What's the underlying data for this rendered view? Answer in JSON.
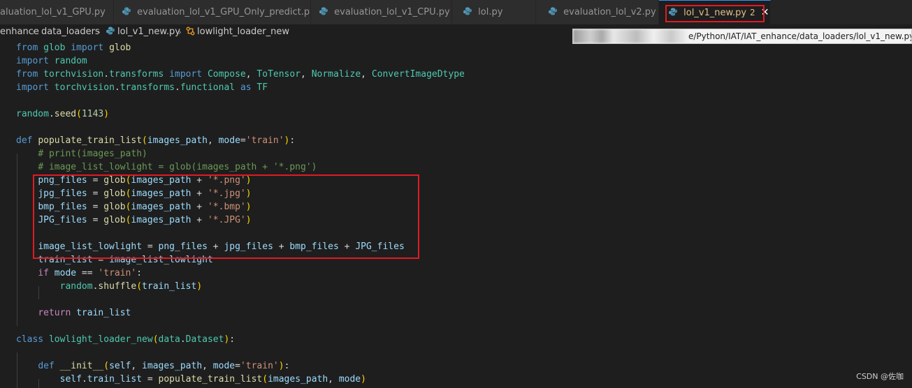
{
  "tabs": [
    {
      "label": "aluation_lol_v1_GPU.py",
      "active": false,
      "icon": "python-file-icon"
    },
    {
      "label": "evaluation_lol_v1_GPU_Only_predict.py",
      "active": false,
      "icon": "python-file-icon"
    },
    {
      "label": "evaluation_lol_v1_CPU.py",
      "active": false,
      "icon": "python-file-icon"
    },
    {
      "label": "lol.py",
      "active": false,
      "icon": "python-file-icon"
    },
    {
      "label": "evaluation_lol_v2.py",
      "active": false,
      "icon": "python-file-icon"
    },
    {
      "label": "lol_v1_new.py",
      "active": true,
      "badge": "2",
      "icon": "python-file-icon",
      "close": "✕"
    }
  ],
  "breadcrumb": {
    "items": [
      "enhance",
      "data_loaders",
      "lol_v1_new.py",
      "lowlight_loader_new"
    ],
    "separator": "›"
  },
  "tooltip": {
    "path_visible": "/Python/IAT/IAT_enhance/data_loaders/lol_v1_new.py",
    "prefix_redacted": "e"
  },
  "code": {
    "lines": [
      [
        [
          "kw",
          "from"
        ],
        [
          "pl",
          " "
        ],
        [
          "mod",
          "glob"
        ],
        [
          "pl",
          " "
        ],
        [
          "kw",
          "import"
        ],
        [
          "pl",
          " "
        ],
        [
          "fn",
          "glob"
        ]
      ],
      [
        [
          "kw",
          "import"
        ],
        [
          "pl",
          " "
        ],
        [
          "mod",
          "random"
        ]
      ],
      [
        [
          "kw",
          "from"
        ],
        [
          "pl",
          " "
        ],
        [
          "mod",
          "torchvision"
        ],
        [
          "pl",
          "."
        ],
        [
          "mod",
          "transforms"
        ],
        [
          "pl",
          " "
        ],
        [
          "kw",
          "import"
        ],
        [
          "pl",
          " "
        ],
        [
          "cls",
          "Compose"
        ],
        [
          "pl",
          ", "
        ],
        [
          "cls",
          "ToTensor"
        ],
        [
          "pl",
          ", "
        ],
        [
          "cls",
          "Normalize"
        ],
        [
          "pl",
          ", "
        ],
        [
          "cls",
          "ConvertImageDtype"
        ]
      ],
      [
        [
          "kw",
          "import"
        ],
        [
          "pl",
          " "
        ],
        [
          "mod",
          "torchvision"
        ],
        [
          "pl",
          "."
        ],
        [
          "mod",
          "transforms"
        ],
        [
          "pl",
          "."
        ],
        [
          "mod",
          "functional"
        ],
        [
          "pl",
          " "
        ],
        [
          "kw",
          "as"
        ],
        [
          "pl",
          " "
        ],
        [
          "mod",
          "TF"
        ]
      ],
      [],
      [
        [
          "mod",
          "random"
        ],
        [
          "pl",
          "."
        ],
        [
          "fn",
          "seed"
        ],
        [
          "par",
          "("
        ],
        [
          "num",
          "1143"
        ],
        [
          "par",
          ")"
        ]
      ],
      [],
      [
        [
          "kw",
          "def"
        ],
        [
          "pl",
          " "
        ],
        [
          "fn",
          "populate_train_list"
        ],
        [
          "par",
          "("
        ],
        [
          "var",
          "images_path"
        ],
        [
          "pl",
          ", "
        ],
        [
          "var",
          "mode"
        ],
        [
          "op",
          "="
        ],
        [
          "str",
          "'train'"
        ],
        [
          "par",
          ")"
        ],
        [
          "pl",
          ":"
        ]
      ],
      [
        [
          "pl",
          "    "
        ],
        [
          "cmt",
          "# print(images_path)"
        ]
      ],
      [
        [
          "pl",
          "    "
        ],
        [
          "cmt",
          "# image_list_lowlight = glob(images_path + '*.png')"
        ]
      ],
      [
        [
          "pl",
          "    "
        ],
        [
          "var",
          "png_files"
        ],
        [
          "op",
          " = "
        ],
        [
          "fn",
          "glob"
        ],
        [
          "par",
          "("
        ],
        [
          "var",
          "images_path"
        ],
        [
          "op",
          " + "
        ],
        [
          "str",
          "'*.png'"
        ],
        [
          "par",
          ")"
        ]
      ],
      [
        [
          "pl",
          "    "
        ],
        [
          "var",
          "jpg_files"
        ],
        [
          "op",
          " = "
        ],
        [
          "fn",
          "glob"
        ],
        [
          "par",
          "("
        ],
        [
          "var",
          "images_path"
        ],
        [
          "op",
          " + "
        ],
        [
          "str",
          "'*.jpg'"
        ],
        [
          "par",
          ")"
        ]
      ],
      [
        [
          "pl",
          "    "
        ],
        [
          "var",
          "bmp_files"
        ],
        [
          "op",
          " = "
        ],
        [
          "fn",
          "glob"
        ],
        [
          "par",
          "("
        ],
        [
          "var",
          "images_path"
        ],
        [
          "op",
          " + "
        ],
        [
          "str",
          "'*.bmp'"
        ],
        [
          "par",
          ")"
        ]
      ],
      [
        [
          "pl",
          "    "
        ],
        [
          "var",
          "JPG_files"
        ],
        [
          "op",
          " = "
        ],
        [
          "fn",
          "glob"
        ],
        [
          "par",
          "("
        ],
        [
          "var",
          "images_path"
        ],
        [
          "op",
          " + "
        ],
        [
          "str",
          "'*.JPG'"
        ],
        [
          "par",
          ")"
        ]
      ],
      [],
      [
        [
          "pl",
          "    "
        ],
        [
          "var",
          "image_list_lowlight"
        ],
        [
          "op",
          " = "
        ],
        [
          "var",
          "png_files"
        ],
        [
          "op",
          " + "
        ],
        [
          "var",
          "jpg_files"
        ],
        [
          "op",
          " + "
        ],
        [
          "var",
          "bmp_files"
        ],
        [
          "op",
          " + "
        ],
        [
          "var",
          "JPG_files"
        ]
      ],
      [
        [
          "pl",
          "    "
        ],
        [
          "var",
          "train_list"
        ],
        [
          "op",
          " = "
        ],
        [
          "var",
          "image_list_lowlight"
        ]
      ],
      [
        [
          "pl",
          "    "
        ],
        [
          "imp",
          "if"
        ],
        [
          "pl",
          " "
        ],
        [
          "var",
          "mode"
        ],
        [
          "op",
          " == "
        ],
        [
          "str",
          "'train'"
        ],
        [
          "pl",
          ":"
        ]
      ],
      [
        [
          "pl",
          "        "
        ],
        [
          "mod",
          "random"
        ],
        [
          "pl",
          "."
        ],
        [
          "fn",
          "shuffle"
        ],
        [
          "par",
          "("
        ],
        [
          "var",
          "train_list"
        ],
        [
          "par",
          ")"
        ]
      ],
      [],
      [
        [
          "pl",
          "    "
        ],
        [
          "imp",
          "return"
        ],
        [
          "pl",
          " "
        ],
        [
          "var",
          "train_list"
        ]
      ],
      [],
      [
        [
          "kw",
          "class"
        ],
        [
          "pl",
          " "
        ],
        [
          "cls",
          "lowlight_loader_new"
        ],
        [
          "par",
          "("
        ],
        [
          "mod",
          "data"
        ],
        [
          "pl",
          "."
        ],
        [
          "cls",
          "Dataset"
        ],
        [
          "par",
          ")"
        ],
        [
          "pl",
          ":"
        ]
      ],
      [],
      [
        [
          "pl",
          "    "
        ],
        [
          "kw",
          "def"
        ],
        [
          "pl",
          " "
        ],
        [
          "fn",
          "__init__"
        ],
        [
          "par",
          "("
        ],
        [
          "var",
          "self"
        ],
        [
          "pl",
          ", "
        ],
        [
          "var",
          "images_path"
        ],
        [
          "pl",
          ", "
        ],
        [
          "var",
          "mode"
        ],
        [
          "op",
          "="
        ],
        [
          "str",
          "'train'"
        ],
        [
          "par",
          ")"
        ],
        [
          "pl",
          ":"
        ]
      ],
      [
        [
          "pl",
          "        "
        ],
        [
          "var",
          "self"
        ],
        [
          "pl",
          "."
        ],
        [
          "var",
          "train_list"
        ],
        [
          "op",
          " = "
        ],
        [
          "fn",
          "populate_train_list"
        ],
        [
          "par",
          "("
        ],
        [
          "var",
          "images_path"
        ],
        [
          "pl",
          ", "
        ],
        [
          "var",
          "mode"
        ],
        [
          "par",
          ")"
        ]
      ]
    ]
  },
  "watermark": "CSDN @佐咖",
  "colors": {
    "background": "#1e1e1e",
    "tab_bar": "#252526",
    "highlight_box": "#e01b24",
    "keyword": "#569cd6",
    "control": "#c586c0",
    "function": "#dcdcaa",
    "variable": "#9cdcfe",
    "type": "#4ec9b0",
    "string": "#ce9178",
    "number": "#b5cea8",
    "comment": "#6a9955"
  }
}
